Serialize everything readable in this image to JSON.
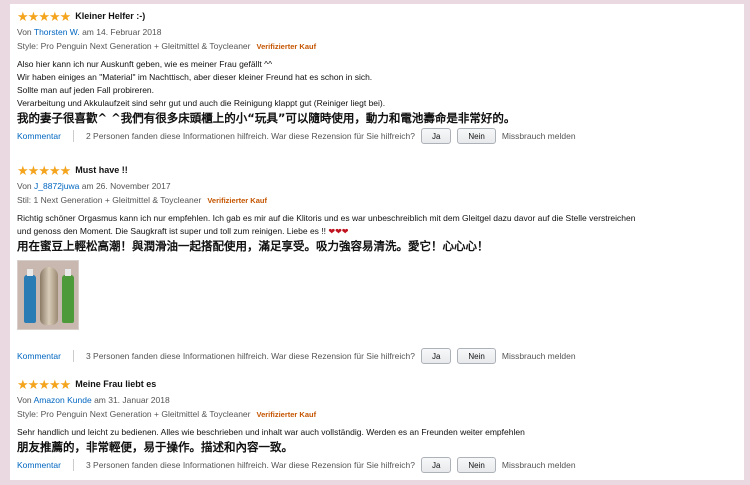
{
  "reviews": [
    {
      "rating": 5,
      "title": "Kleiner Helfer :-)",
      "by_prefix": "Von",
      "author": "Thorsten W.",
      "date": "am 14. Februar 2018",
      "meta": "Style: Pro Penguin Next Generation + Gleitmittel & Toycleaner",
      "verified": "Verifizierter Kauf",
      "body": [
        "Also hier kann ich nur Auskunft geben, wie es meiner Frau gefällt ^^",
        "Wir haben einiges an \"Material\" im Nachttisch, aber dieser kleiner Freund hat es schon in sich.",
        "Sollte man auf jeden Fall probireren.",
        "Verarbeitung und Akkulaufzeit sind sehr gut und auch die Reinigung klappt gut (Reiniger liegt bei)."
      ],
      "translation": "我的妻子很喜歡^ ^我們有很多床頭櫃上的小“玩具”可以隨時使用，動力和電池壽命是非常好的。",
      "comment_label": "Kommentar",
      "helpful": "2 Personen fanden diese Informationen hilfreich. War diese Rezension für Sie hilfreich?",
      "yes": "Ja",
      "no": "Nein",
      "report": "Missbrauch melden"
    },
    {
      "rating": 5,
      "title": "Must have !!",
      "by_prefix": "Von",
      "author": "J_8872juwa",
      "date": "am 26. November 2017",
      "meta": "Stil: 1 Next Generation + Gleitmittel & Toycleaner",
      "verified": "Verifizierter Kauf",
      "body": [
        "Richtig schöner Orgasmus kann ich nur empfehlen. Ich gab es mir auf die Klitoris und es war unbeschreiblich mit dem Gleitgel dazu davor auf die Stelle verstreichen",
        "und genoss den Moment. Die Saugkraft ist super und toll zum reinigen. Liebe es !!"
      ],
      "hearts": "❤❤❤",
      "translation": "用在蜜豆上輕松高潮！與潤滑油一起搭配使用，滿足享受。吸力強容易清洗。愛它！心心心！",
      "comment_label": "Kommentar",
      "helpful": "3 Personen fanden diese Informationen hilfreich. War diese Rezension für Sie hilfreich?",
      "yes": "Ja",
      "no": "Nein",
      "report": "Missbrauch melden"
    },
    {
      "rating": 5,
      "title": "Meine Frau liebt es",
      "by_prefix": "Von",
      "author": "Amazon Kunde",
      "date": "am 31. Januar 2018",
      "meta": "Style: Pro Penguin Next Generation + Gleitmittel & Toycleaner",
      "verified": "Verifizierter Kauf",
      "body": [
        "Sehr handlich und leicht zu bedienen. Alles wie beschrieben und inhalt war auch vollständig. Werden es an Freunden weiter empfehlen"
      ],
      "translation": "朋友推薦的，非常輕便，易于操作。描述和內容一致。",
      "comment_label": "Kommentar",
      "helpful": "3 Personen fanden diese Informationen hilfreich. War diese Rezension für Sie hilfreich?",
      "yes": "Ja",
      "no": "Nein",
      "report": "Missbrauch melden"
    }
  ],
  "colors": {
    "star": "#f4a41d",
    "link": "#0066c0",
    "verified": "#c45500",
    "background": "#ead9e0"
  }
}
